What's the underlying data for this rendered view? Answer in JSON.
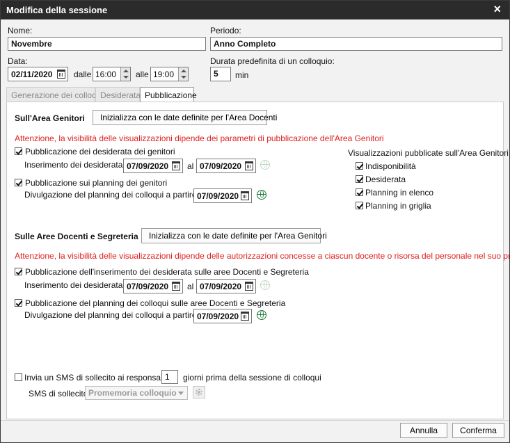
{
  "window": {
    "title": "Modifica della sessione",
    "close_icon": "×"
  },
  "form": {
    "nome_label": "Nome:",
    "nome_value": "Novembre",
    "periodo_label": "Periodo:",
    "periodo_value": "Anno Completo",
    "data_label": "Data:",
    "data_value": "02/11/2020",
    "dalle_label": "dalle",
    "dalle_value": "16:00",
    "alle_label": "alle",
    "alle_value": "19:00",
    "durata_label": "Durata predefinita di un colloquio:",
    "durata_value": "5",
    "durata_unit": "min"
  },
  "tabs": [
    {
      "label": "Generazione dei colloqui",
      "active": false
    },
    {
      "label": "Desiderata",
      "active": false
    },
    {
      "label": "Pubblicazione",
      "active": true
    }
  ],
  "genitori": {
    "title": "Sull'Area Genitori",
    "init_button": "Inizializza con le date definite per l'Area Docenti",
    "warning": "Attenzione, la visibilità delle visualizzazioni dipende dei parametri di pubblicazione dell'Area Genitori",
    "pub_desiderata": {
      "label": "Pubblicazione dei desiderata dei genitori",
      "checked": true,
      "range_label": "Inserimento dei desiderata di",
      "from": "07/09/2020",
      "al_label": "al",
      "to": "07/09/2020"
    },
    "pub_planning": {
      "label": "Pubblicazione sui planning dei genitori",
      "checked": true,
      "range_label": "Divulgazione del planning dei colloqui a partire dal",
      "from": "07/09/2020"
    },
    "visualizzazioni": {
      "title": "Visualizzazioni pubblicate sull'Area Genitori",
      "items": [
        {
          "label": "Indisponibilità",
          "checked": true
        },
        {
          "label": "Desiderata",
          "checked": true
        },
        {
          "label": "Planning in elenco",
          "checked": true
        },
        {
          "label": "Planning in griglia",
          "checked": true
        }
      ]
    }
  },
  "docenti": {
    "title": "Sulle Aree Docenti e Segreteria",
    "init_button": "Inizializza con le date definite per l'Area Genitori",
    "warning": "Attenzione, la visibilità delle visualizzazioni dipende delle autorizzazioni concesse a ciascun docente o risorsa del personale nel suo profilo",
    "pub_desiderata": {
      "label": "Pubblicazione dell'inserimento dei desiderata sulle aree Docenti e Segreteria",
      "checked": true,
      "range_label": "Inserimento dei desiderata di",
      "from": "07/09/2020",
      "al_label": "al",
      "to": "07/09/2020"
    },
    "pub_planning": {
      "label": "Pubblicazione del planning dei colloqui sulle aree Docenti e Segreteria",
      "checked": true,
      "range_label": "Divulgazione del planning dei colloqui a partire dal",
      "from": "07/09/2020"
    }
  },
  "sms": {
    "label_before": "Invia un SMS di sollecito ai responsabili",
    "checked": false,
    "days_value": "1",
    "label_after": "giorni prima della sessione di colloqui",
    "sollecito_label": "SMS di sollecito",
    "sollecito_value": "Promemoria colloquio"
  },
  "footer": {
    "cancel": "Annulla",
    "confirm": "Conferma"
  }
}
